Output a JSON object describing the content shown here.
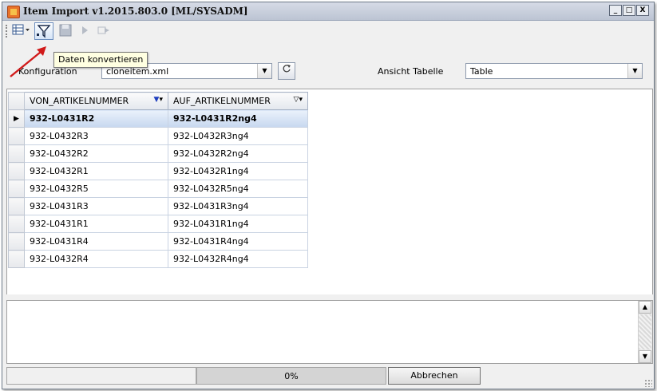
{
  "window": {
    "title": "Item Import v1.2015.803.0 [ML/SYSADM]",
    "btn_minimize": "_",
    "btn_maximize": "□",
    "btn_close": "X"
  },
  "toolbar": {
    "tooltip": "Daten konvertieren",
    "icons": [
      "grid-view-icon",
      "filter-convert-icon",
      "save-icon",
      "play-icon",
      "export-icon"
    ]
  },
  "config": {
    "label": "Konfiguration",
    "value": "cloneitem.xml",
    "ansicht_label": "Ansicht Tabelle",
    "ansicht_value": "Table"
  },
  "grid": {
    "columns": [
      "VON_ARTIKELNUMMER",
      "AUF_ARTIKELNUMMER"
    ],
    "rows": [
      [
        "932-L0431R2",
        "932-L0431R2ng4"
      ],
      [
        "932-L0432R3",
        "932-L0432R3ng4"
      ],
      [
        "932-L0432R2",
        "932-L0432R2ng4"
      ],
      [
        "932-L0432R1",
        "932-L0432R1ng4"
      ],
      [
        "932-L0432R5",
        "932-L0432R5ng4"
      ],
      [
        "932-L0431R3",
        "932-L0431R3ng4"
      ],
      [
        "932-L0431R1",
        "932-L0431R1ng4"
      ],
      [
        "932-L0431R4",
        "932-L0431R4ng4"
      ],
      [
        "932-L0432R4",
        "932-L0432R4ng4"
      ]
    ],
    "selected_row": 0
  },
  "status": {
    "progress": "0%",
    "cancel_label": "Abbrechen"
  },
  "colors": {
    "annotation_arrow": "#d11a1a",
    "filter_active": "#1f3fbf"
  }
}
